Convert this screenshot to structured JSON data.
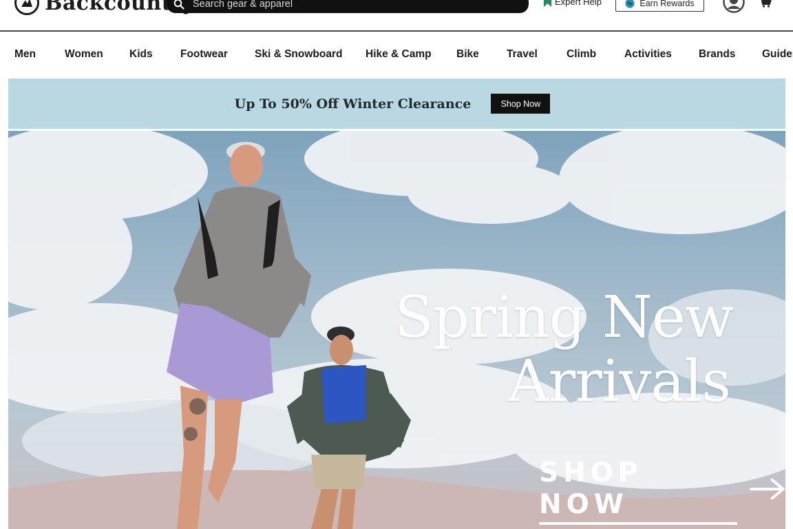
{
  "header": {
    "logo_text": "Backcountry",
    "search_placeholder": "Search gear & apparel",
    "expert_help": "Expert Help",
    "earn_rewards": "Earn Rewards"
  },
  "nav": {
    "items": [
      "Men",
      "Women",
      "Kids",
      "Footwear",
      "Ski & Snowboard",
      "Hike & Camp",
      "Bike",
      "Travel",
      "Climb",
      "Activities",
      "Brands",
      "Guides"
    ]
  },
  "promo": {
    "text": "Up To 50% Off Winter Clearance",
    "button": "Shop Now"
  },
  "hero": {
    "title_line1": "Spring New",
    "title_line2": "Arrivals",
    "cta": "SHOP NOW"
  },
  "icons": {
    "search": "search-icon",
    "expert": "bookmark-icon",
    "rewards": "globe-icon",
    "account": "account-icon",
    "cart": "cart-icon",
    "cta": "arrow-right-icon"
  },
  "colors": {
    "promo_bg": "#b9d8e2",
    "expert_accent": "#1f8a5a",
    "rewards_globe": "#2a8fb0"
  }
}
